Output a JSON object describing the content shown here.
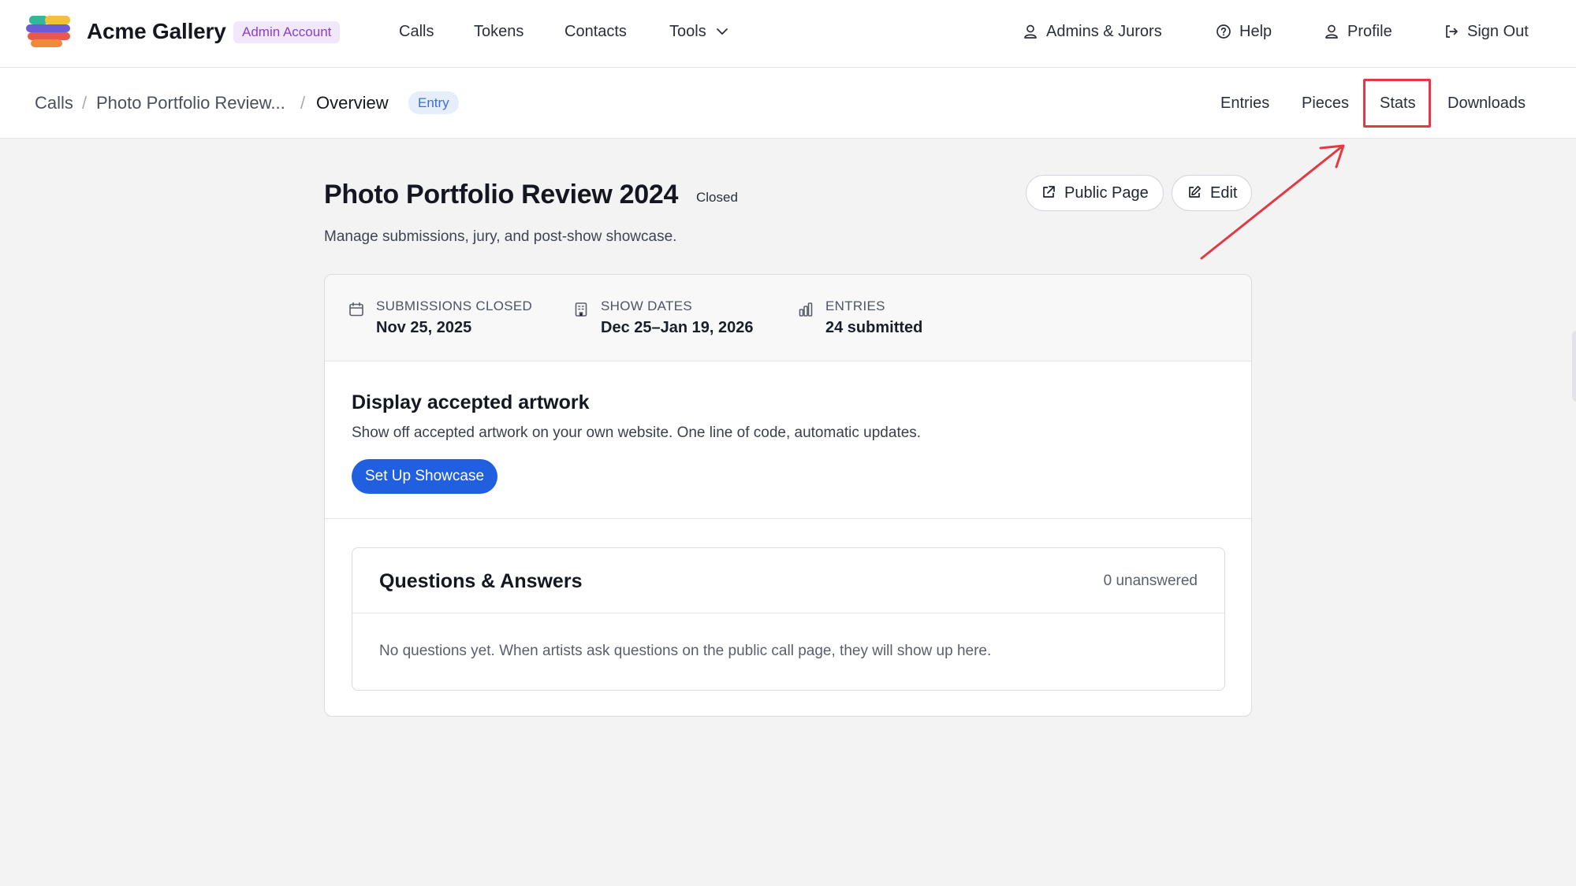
{
  "app": {
    "brand": "Acme Gallery",
    "account_badge": "Admin Account",
    "colors": {
      "accent": "#1f5fe0",
      "badge_purple": "#8a3ec9",
      "highlight_red": "#e23a45"
    }
  },
  "topnav": {
    "links": [
      "Calls",
      "Tokens",
      "Contacts",
      "Tools"
    ],
    "right": [
      "Admins & Jurors",
      "Help",
      "Profile",
      "Sign Out"
    ]
  },
  "breadcrumb": {
    "items": [
      "Calls",
      "Photo Portfolio Review...",
      "Overview"
    ],
    "separator": "/",
    "badge": "Entry"
  },
  "subtabs": [
    "Entries",
    "Pieces",
    "Stats",
    "Downloads"
  ],
  "page": {
    "title": "Photo Portfolio Review 2024",
    "status": "Closed",
    "description": "Manage submissions, jury, and post-show showcase.",
    "buttons": {
      "public_page": "Public Page",
      "edit": "Edit"
    }
  },
  "stats": [
    {
      "label": "SUBMISSIONS CLOSED",
      "value": "Nov 25, 2025",
      "icon": "calendar-icon"
    },
    {
      "label": "SHOW DATES",
      "value": "Dec 25–Jan 19, 2026",
      "icon": "building-icon"
    },
    {
      "label": "ENTRIES",
      "value": "24 submitted",
      "icon": "bar-chart-icon"
    }
  ],
  "showcase": {
    "title": "Display accepted artwork",
    "description": "Show off accepted artwork on your own website. One line of code, automatic updates.",
    "button": "Set Up Showcase"
  },
  "qa": {
    "title": "Questions & Answers",
    "count": "0 unanswered",
    "empty": "No questions yet. When artists ask questions on the public call page, they will show up here."
  }
}
